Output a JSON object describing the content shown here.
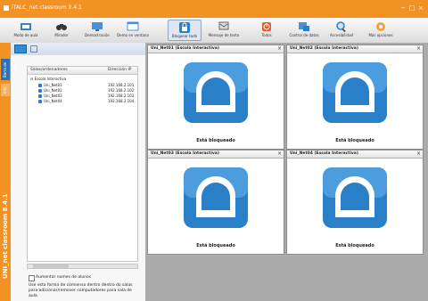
{
  "window": {
    "title": "iTALC_net classroom 8.4.1",
    "controls": [
      "−",
      "□",
      "×"
    ]
  },
  "toolbar": {
    "buttons": [
      {
        "label": "Modo de aula",
        "icon": "classroom-icon",
        "active": false
      },
      {
        "label": "Mirador",
        "icon": "binoculars-icon",
        "active": false
      },
      {
        "label": "Demostración",
        "icon": "demo-icon",
        "active": false
      },
      {
        "label": "Demo en ventana",
        "icon": "window-demo-icon",
        "active": false
      },
      {
        "label": "Bloquear todo",
        "icon": "lock-icon",
        "active": true
      },
      {
        "label": "Mensaje de texto",
        "icon": "message-icon",
        "active": false
      },
      {
        "label": "Todos",
        "icon": "power-icon",
        "active": false
      },
      {
        "label": "Control de datos",
        "icon": "data-icon",
        "active": false
      },
      {
        "label": "Accesibilidad",
        "icon": "magnifier-icon",
        "active": false
      },
      {
        "label": "Más opciones",
        "icon": "more-icon",
        "active": false
      }
    ]
  },
  "sidebar": {
    "vertical_tabs": [
      "Barra de aula",
      "Info"
    ],
    "vertical_title": "UNI_net classroom 8.4.1",
    "tree_header": {
      "col1": "Salas/ordenadores",
      "col2": "Dirección IP"
    },
    "tree_root": "Escola Interactiva",
    "computers": [
      {
        "name": "Uni_Net01",
        "ip": "192.168.2.101"
      },
      {
        "name": "Uni_Net02",
        "ip": "192.168.2.102"
      },
      {
        "name": "Uni_Net03",
        "ip": "192.168.2.103"
      },
      {
        "name": "Uni_Net04",
        "ip": "192.168.2.104"
      }
    ],
    "checkbox_label": "Aumentar nomes de alunos",
    "description": "Use esta forma de comienso dentro dentro do salas para adicionar/remover computadores para sala de aula."
  },
  "tiles": [
    {
      "name": "Uni_Net01 (Escola Interactiva)",
      "status": "Está bloqueado"
    },
    {
      "name": "Uni_Net02 (Escola Interactiva)",
      "status": "Está bloqueado"
    },
    {
      "name": "Uni_Net03 (Escola Interactiva)",
      "status": "Está bloqueado"
    },
    {
      "name": "Uni_Net04 (Escola Interactiva)",
      "status": "Está bloqueado"
    }
  ],
  "colors": {
    "accent": "#f29224",
    "lock_blue": "#2a7fc9",
    "tab_blue": "#2f6fb8"
  }
}
